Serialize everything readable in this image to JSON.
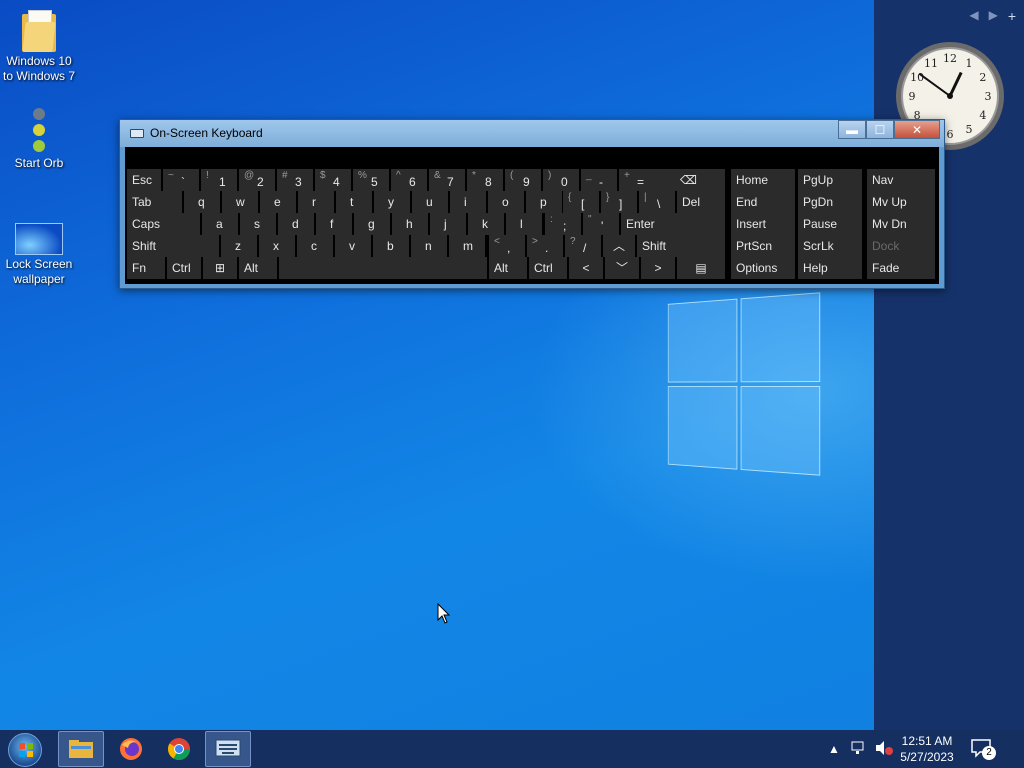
{
  "desktop_icons": [
    {
      "label": "Windows 10 to Windows 7",
      "icon": "folder-icon"
    },
    {
      "label": "Start Orb",
      "icon": "orb-icon"
    },
    {
      "label": "Lock Screen wallpaper",
      "icon": "wallpaper-icon"
    }
  ],
  "sidebar": {
    "prev": "◀",
    "next": "▶",
    "add": "+"
  },
  "clock": {
    "numbers": [
      "12",
      "1",
      "2",
      "3",
      "4",
      "5",
      "6",
      "7",
      "8",
      "9",
      "10",
      "11"
    ],
    "hour": 12,
    "minute": 51
  },
  "osk": {
    "title": "On-Screen Keyboard",
    "rows": [
      [
        {
          "s": "~",
          "m": "`"
        },
        {
          "s": "!",
          "m": "1"
        },
        {
          "s": "@",
          "m": "2"
        },
        {
          "s": "#",
          "m": "3"
        },
        {
          "s": "$",
          "m": "4"
        },
        {
          "s": "%",
          "m": "5"
        },
        {
          "s": "^",
          "m": "6"
        },
        {
          "s": "&",
          "m": "7"
        },
        {
          "s": "*",
          "m": "8"
        },
        {
          "s": "(",
          "m": "9"
        },
        {
          "s": ")",
          "m": "0"
        },
        {
          "s": "_",
          "m": "-"
        },
        {
          "s": "+",
          "m": "="
        }
      ],
      [
        "q",
        "w",
        "e",
        "r",
        "t",
        "y",
        "u",
        "i",
        "o",
        "p"
      ],
      [
        "a",
        "s",
        "d",
        "f",
        "g",
        "h",
        "j",
        "k",
        "l"
      ],
      [
        "z",
        "x",
        "c",
        "v",
        "b",
        "n",
        "m"
      ]
    ],
    "keys": {
      "esc": "Esc",
      "tab": "Tab",
      "caps": "Caps",
      "shift": "Shift",
      "fn": "Fn",
      "ctrl": "Ctrl",
      "alt": "Alt",
      "del": "Del",
      "enter": "Enter",
      "bracket_open_shift": "{",
      "bracket_open": "[",
      "bracket_close_shift": "}",
      "bracket_close": "]",
      "pipe": "|",
      "backslash": "\\",
      "colon": ":",
      "semicolon": ";",
      "quote_shift": "\"",
      "quote": "'",
      "lt": "<",
      "comma": ",",
      "gt": ">",
      "period": ".",
      "question": "?",
      "slash": "/",
      "home": "Home",
      "pgup": "PgUp",
      "nav": "Nav",
      "end": "End",
      "pgdn": "PgDn",
      "mvup": "Mv Up",
      "insert": "Insert",
      "pause": "Pause",
      "mvdn": "Mv Dn",
      "prtscn": "PrtScn",
      "scrlk": "ScrLk",
      "dock": "Dock",
      "options": "Options",
      "help": "Help",
      "fade": "Fade"
    }
  },
  "taskbar": {
    "apps": [
      "file-explorer-icon",
      "firefox-icon",
      "chrome-icon",
      "on-screen-keyboard-icon"
    ],
    "time": "12:51 AM",
    "date": "5/27/2023",
    "notification_count": "2"
  }
}
